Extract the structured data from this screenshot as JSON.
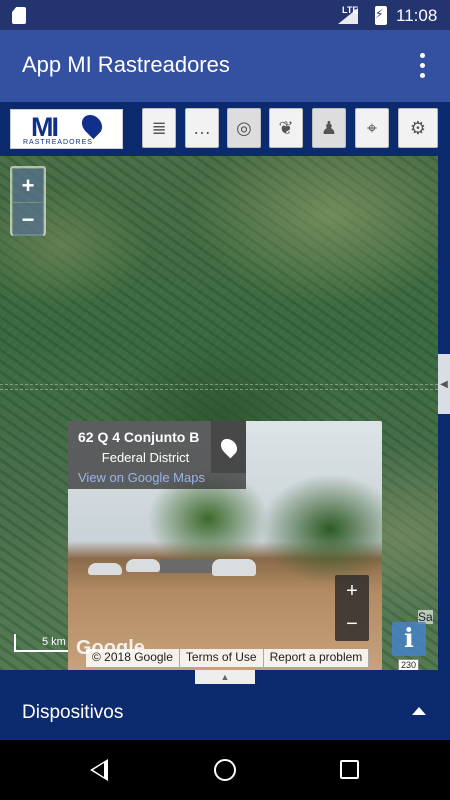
{
  "status_bar": {
    "network": "LTE",
    "time": "11:08"
  },
  "app_bar": {
    "title": "App MI Rastreadores",
    "overflow_icon": "more-vert-icon"
  },
  "toolbar": {
    "logo_text": "MI",
    "logo_subtitle": "RASTREADORES",
    "buttons": [
      {
        "name": "document-icon",
        "glyph": "≣"
      },
      {
        "name": "chat-icon",
        "glyph": "…"
      },
      {
        "name": "target-icon",
        "glyph": "◎"
      },
      {
        "name": "paw-icon",
        "glyph": "❦"
      },
      {
        "name": "person-pin-icon",
        "glyph": "♟"
      },
      {
        "name": "crosshair-icon",
        "glyph": "⌖"
      },
      {
        "name": "settings-icon",
        "glyph": "⚙"
      }
    ]
  },
  "map": {
    "zoom_in": "+",
    "zoom_out": "−",
    "scale": "5 km",
    "info": "i",
    "place_fragment": "Sa",
    "road_marker": "230"
  },
  "street_view": {
    "address": "62 Q 4 Conjunto B",
    "region": "Federal District",
    "link": "View on Google Maps",
    "zoom_in": "+",
    "zoom_out": "−",
    "brand": "Google",
    "copyright": "© 2018 Google",
    "terms": "Terms of Use",
    "report": "Report a problem"
  },
  "bottom_sheet": {
    "label": "Dispositivos"
  }
}
